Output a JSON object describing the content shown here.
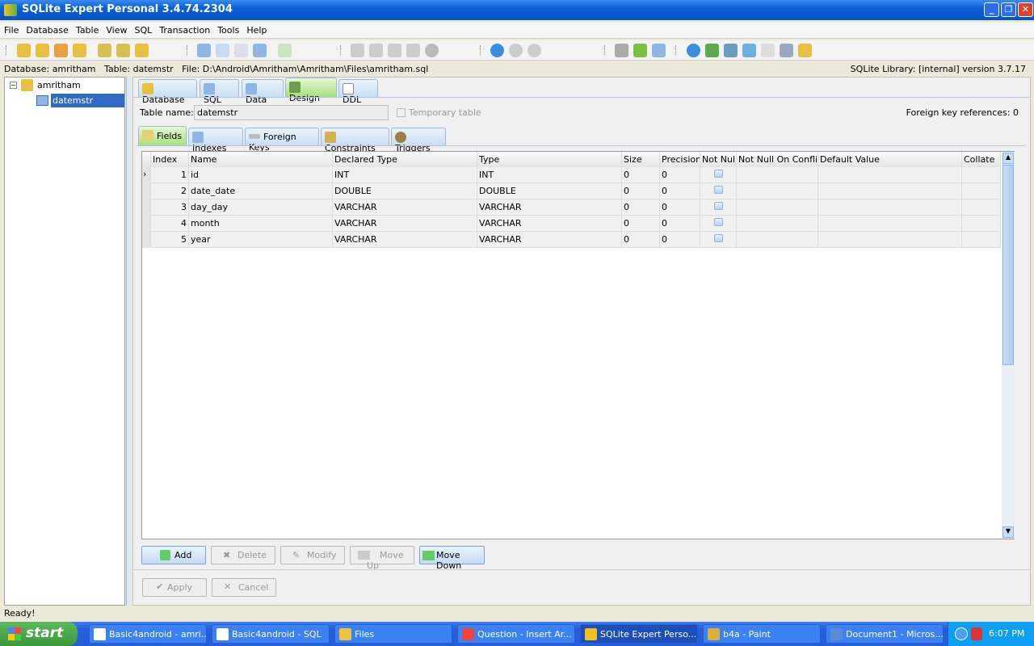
{
  "window": {
    "title": "SQLite Expert Personal 3.4.74.2304"
  },
  "menu": [
    "File",
    "Database",
    "Table",
    "View",
    "SQL",
    "Transaction",
    "Tools",
    "Help"
  ],
  "infobar": {
    "left": "Database: amritham   Table: datemstr   File: D:\\Android\\Amritham\\Amritham\\Files\\amritham.sql",
    "right": "SQLite Library: [internal] version 3.7.17"
  },
  "tree": {
    "database": "amritham",
    "table": "datemstr"
  },
  "tabs": [
    "Database",
    "SQL",
    "Data",
    "Design",
    "DDL"
  ],
  "design": {
    "table_name_label": "Table name:",
    "table_name": "datemstr",
    "temporary_label": "Temporary table",
    "fk_refs": "Foreign key references: 0"
  },
  "subtabs": [
    "Fields",
    "Indexes",
    "Foreign Keys",
    "Constraints",
    "Triggers"
  ],
  "grid": {
    "columns": [
      "Index",
      "Name",
      "Declared Type",
      "Type",
      "Size",
      "Precision",
      "Not Null",
      "Not Null On Conflict",
      "Default Value",
      "Collate"
    ],
    "rows": [
      [
        "1",
        "id",
        "INT",
        "INT",
        "0",
        "0"
      ],
      [
        "2",
        "date_date",
        "DOUBLE",
        "DOUBLE",
        "0",
        "0"
      ],
      [
        "3",
        "day_day",
        "VARCHAR",
        "VARCHAR",
        "0",
        "0"
      ],
      [
        "4",
        "month",
        "VARCHAR",
        "VARCHAR",
        "0",
        "0"
      ],
      [
        "5",
        "year",
        "VARCHAR",
        "VARCHAR",
        "0",
        "0"
      ]
    ]
  },
  "buttons": {
    "add": "Add",
    "delete": "Delete",
    "modify": "Modify",
    "move_up": "Move Up",
    "move_down": "Move Down",
    "apply": "Apply",
    "cancel": "Cancel"
  },
  "status": "Ready!",
  "taskbar": {
    "start": "start",
    "tasks": [
      "Basic4android - amri...",
      "Basic4android - SQL",
      "Files",
      "Question - Insert Ar...",
      "SQLite Expert Perso...",
      "b4a - Paint",
      "Document1 - Micros..."
    ],
    "clock": "6:07 PM"
  }
}
